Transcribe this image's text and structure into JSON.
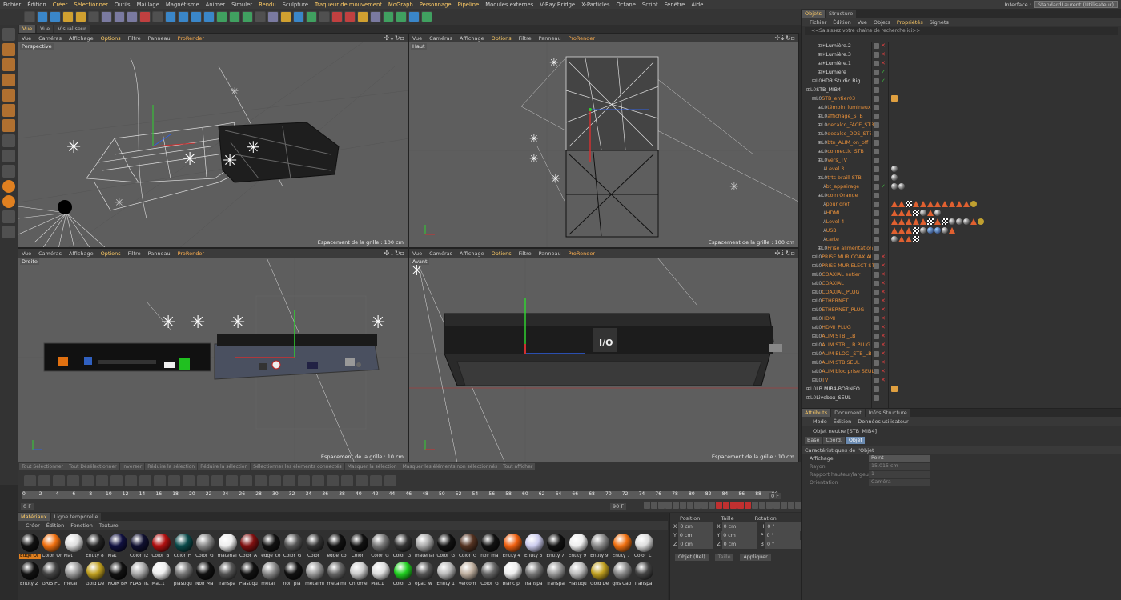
{
  "menubar": [
    "Fichier",
    "Édition",
    "Créer",
    "Sélectionner",
    "Outils",
    "Maillage",
    "Magnétisme",
    "Animer",
    "Simuler",
    "Rendu",
    "Sculpture",
    "Traqueur de mouvement",
    "MoGraph",
    "Personnage",
    "Pipeline",
    "Modules externes",
    "V-Ray Bridge",
    "X-Particles",
    "Octane",
    "Script",
    "Fenêtre",
    "Aide"
  ],
  "interface": {
    "label": "Interface :",
    "value": "StandardLaurent (Utilisateur)"
  },
  "viewport_tabs": [
    "Vue",
    "Vue",
    "Visualiseur"
  ],
  "viewport_menu": {
    "vue": "Vue",
    "cameras": "Caméras",
    "affichage": "Affichage",
    "options": "Options",
    "filtre": "Filtre",
    "panneau": "Panneau",
    "prorender": "ProRender"
  },
  "viewports": [
    {
      "name": "Perspective",
      "grid": "Espacement de la grille : 100 cm"
    },
    {
      "name": "Haut",
      "grid": "Espacement de la grille : 100 cm"
    },
    {
      "name": "Droite",
      "grid": "Espacement de la grille : 10 cm"
    },
    {
      "name": "Avant",
      "grid": "Espacement de la grille : 10 cm"
    }
  ],
  "scene_label": "I/O",
  "right_tabs": [
    "Objets",
    "Structure"
  ],
  "obj_menu": [
    "Fichier",
    "Édition",
    "Vue",
    "Objets",
    "Propriétés",
    "Signets"
  ],
  "search_placeholder": "<<Saisissez votre chaîne de recherche ici>>",
  "objects": [
    {
      "name": "Lumière.2",
      "indent": 2,
      "color": "w",
      "x": "r"
    },
    {
      "name": "Lumière.3",
      "indent": 2,
      "color": "w",
      "x": "r"
    },
    {
      "name": "Lumière.1",
      "indent": 2,
      "color": "w",
      "x": "r"
    },
    {
      "name": "Lumière",
      "indent": 2,
      "color": "w",
      "x": "g"
    },
    {
      "name": "HDR Studio Rig",
      "indent": 1,
      "color": "w",
      "x": "g"
    },
    {
      "name": "STB_MIB4",
      "indent": 0,
      "color": "w",
      "x": ""
    },
    {
      "name": "STB_entier03",
      "indent": 1,
      "color": "o",
      "x": ""
    },
    {
      "name": "témoin_lumineux",
      "indent": 2,
      "color": "o",
      "x": ""
    },
    {
      "name": "affichage_STB",
      "indent": 2,
      "color": "o",
      "x": ""
    },
    {
      "name": "decalco_FACE_STB",
      "indent": 2,
      "color": "o",
      "x": ""
    },
    {
      "name": "decalco_DOS_STB",
      "indent": 2,
      "color": "o",
      "x": ""
    },
    {
      "name": "btn_ALIM_on_off",
      "indent": 2,
      "color": "o",
      "x": ""
    },
    {
      "name": "connectic_STB",
      "indent": 2,
      "color": "o",
      "x": ""
    },
    {
      "name": "vers_TV",
      "indent": 2,
      "color": "o",
      "x": ""
    },
    {
      "name": "Level 3",
      "indent": 3,
      "color": "o",
      "x": ""
    },
    {
      "name": "trts braill STB",
      "indent": 2,
      "color": "o",
      "x": ""
    },
    {
      "name": "bt_appairage",
      "indent": 3,
      "color": "o",
      "x": "g"
    },
    {
      "name": "coin Orange",
      "indent": 2,
      "color": "o",
      "x": ""
    },
    {
      "name": "pour dref",
      "indent": 3,
      "color": "o",
      "x": ""
    },
    {
      "name": "HDMI",
      "indent": 3,
      "color": "o",
      "x": ""
    },
    {
      "name": "Level 4",
      "indent": 3,
      "color": "o",
      "x": ""
    },
    {
      "name": "USB",
      "indent": 3,
      "color": "o",
      "x": ""
    },
    {
      "name": "carte",
      "indent": 3,
      "color": "o",
      "x": ""
    },
    {
      "name": "Prise alimentation",
      "indent": 2,
      "color": "o",
      "x": ""
    },
    {
      "name": "PRISE MUR COAXIAL",
      "indent": 1,
      "color": "o",
      "x": "r"
    },
    {
      "name": "PRISE MUR ELECT STB",
      "indent": 1,
      "color": "o",
      "x": "r"
    },
    {
      "name": "COAXIAL entier",
      "indent": 1,
      "color": "o",
      "x": "r"
    },
    {
      "name": "COAXIAL",
      "indent": 1,
      "color": "o",
      "x": "r"
    },
    {
      "name": "COAXIAL_PLUG",
      "indent": 1,
      "color": "o",
      "x": "r"
    },
    {
      "name": "ETHERNET",
      "indent": 1,
      "color": "o",
      "x": "r"
    },
    {
      "name": "ETHERNET_PLUG",
      "indent": 1,
      "color": "o",
      "x": "r"
    },
    {
      "name": "HDMI",
      "indent": 1,
      "color": "o",
      "x": "r"
    },
    {
      "name": "HDMI_PLUG",
      "indent": 1,
      "color": "o",
      "x": "r"
    },
    {
      "name": "ALIM STB _LB",
      "indent": 1,
      "color": "o",
      "x": "r"
    },
    {
      "name": "ALIM STB _LB PLUG",
      "indent": 1,
      "color": "o",
      "x": "r"
    },
    {
      "name": "ALIM BLOC _STB_LB",
      "indent": 1,
      "color": "o",
      "x": "r"
    },
    {
      "name": "ALIM STB SEUL",
      "indent": 1,
      "color": "o",
      "x": "r"
    },
    {
      "name": "ALIM bloc prise SEUL",
      "indent": 1,
      "color": "o",
      "x": "r"
    },
    {
      "name": "TV",
      "indent": 1,
      "color": "o",
      "x": "r"
    },
    {
      "name": "LB MIB4-BORNEO",
      "indent": 0,
      "color": "w",
      "x": ""
    },
    {
      "name": "Livebox_SEUL",
      "indent": 0,
      "color": "w",
      "x": ""
    }
  ],
  "attr_tabs": [
    "Attributs",
    "Document",
    "Infos Structure"
  ],
  "attr_menu": [
    "Mode",
    "Édition",
    "Données utilisateur"
  ],
  "attr_title": "Objet neutre [STB_MIB4]",
  "attr_subtabs": [
    "Base",
    "Coord.",
    "Objet"
  ],
  "attr_section": "Caractéristiques de l'Objet",
  "attr_rows": [
    {
      "label": "Affichage",
      "value": "Point"
    },
    {
      "label": "Rayon",
      "value": "15.015 cm"
    },
    {
      "label": "Rapport hauteur/largeur",
      "value": "1"
    },
    {
      "label": "Orientation",
      "value": "Caméra"
    }
  ],
  "timeline_buttons": [
    "Tout Sélectionner",
    "Tout Désélectionner",
    "Inverser",
    "Réduire la sélection",
    "Réduire la sélection",
    "Sélectionner les éléments connectés",
    "Masquer la sélection",
    "Masquer les éléments non sélectionnés",
    "Tout afficher"
  ],
  "ruler": [
    0,
    2,
    4,
    6,
    8,
    10,
    12,
    14,
    16,
    18,
    20,
    22,
    24,
    26,
    28,
    30,
    32,
    34,
    36,
    38,
    40,
    42,
    44,
    46,
    48,
    50,
    52,
    54,
    56,
    58,
    60,
    62,
    64,
    66,
    68,
    70,
    72,
    74,
    76,
    78,
    80,
    82,
    84,
    86,
    88,
    90
  ],
  "frame_start": "0 F",
  "frame_end": "90 F",
  "frame_cur": "0 F",
  "mat_tabs": [
    "Matériaux",
    "Ligne temporelle"
  ],
  "mat_menu": [
    "Créer",
    "Édition",
    "Fonction",
    "Texture"
  ],
  "materials": [
    {
      "name": "Edge Or",
      "c": "#111111",
      "sel": true
    },
    {
      "name": "Color_Or",
      "c": "#f07010"
    },
    {
      "name": "Mat",
      "c": "#dddddd"
    },
    {
      "name": "Entity 8",
      "c": "#222222"
    },
    {
      "name": "Mat",
      "c": "#101040"
    },
    {
      "name": "Color_I2",
      "c": "#101030"
    },
    {
      "name": "Color_B",
      "c": "#b01010"
    },
    {
      "name": "Color_H",
      "c": "#0a4a4a"
    },
    {
      "name": "Color_G",
      "c": "#888888"
    },
    {
      "name": "material",
      "c": "#eeeeee"
    },
    {
      "name": "Color_A",
      "c": "#801010"
    },
    {
      "name": "edge_co",
      "c": "#111111"
    },
    {
      "name": "Color_G",
      "c": "#555555"
    },
    {
      "name": "_Color",
      "c": "#333333"
    },
    {
      "name": "edge_co",
      "c": "#111111"
    },
    {
      "name": "_Color",
      "c": "#111111"
    },
    {
      "name": "Color_G",
      "c": "#777777"
    },
    {
      "name": "Color_G",
      "c": "#333333"
    },
    {
      "name": "material",
      "c": "#aaaaaa"
    },
    {
      "name": "Color_G",
      "c": "#111111"
    },
    {
      "name": "Color_G",
      "c": "#553322"
    },
    {
      "name": "noir ma",
      "c": "#111111"
    },
    {
      "name": "Entity 4",
      "c": "#f06010"
    },
    {
      "name": "Entity 5",
      "c": "#ccccee"
    },
    {
      "name": "Entity 7",
      "c": "#111111"
    },
    {
      "name": "Entity 9",
      "c": "#eeeeee"
    },
    {
      "name": "Entity 9",
      "c": "#888888"
    },
    {
      "name": "Entity 7",
      "c": "#f07010"
    },
    {
      "name": "Color_L",
      "c": "#dddddd"
    },
    {
      "name": "Entity 2",
      "c": "#111111"
    },
    {
      "name": "GRIS PL",
      "c": "#444444"
    },
    {
      "name": "metal",
      "c": "#999999"
    },
    {
      "name": "Gold De",
      "c": "#c0a020"
    },
    {
      "name": "NOIR BR",
      "c": "#111111"
    },
    {
      "name": "PLASTIK",
      "c": "#aaaaaa"
    },
    {
      "name": "Mat.1",
      "c": "#eeeeee"
    },
    {
      "name": "plastiqu",
      "c": "#777777"
    },
    {
      "name": "Noir Ma",
      "c": "#111111"
    },
    {
      "name": "Transpa",
      "c": "#555555"
    },
    {
      "name": "Plastiqu",
      "c": "#111111"
    },
    {
      "name": "metal",
      "c": "#888888"
    },
    {
      "name": "noir pla",
      "c": "#111111"
    },
    {
      "name": "metalmi",
      "c": "#999999"
    },
    {
      "name": "metalmi",
      "c": "#666666"
    },
    {
      "name": "Chrome",
      "c": "#cccccc"
    },
    {
      "name": "Mat.1",
      "c": "#dddddd"
    },
    {
      "name": "Color_G",
      "c": "#20d020"
    },
    {
      "name": "opac_w",
      "c": "#555555"
    },
    {
      "name": "Entity 1",
      "c": "#bbbbbb"
    },
    {
      "name": "vercom",
      "c": "#c0b0a0"
    },
    {
      "name": "Color_G",
      "c": "#666666"
    },
    {
      "name": "blanc pl",
      "c": "#eeeeee"
    },
    {
      "name": "Transpa",
      "c": "#777777"
    },
    {
      "name": "Transpa",
      "c": "#999999"
    },
    {
      "name": "Plastiqu",
      "c": "#bbbbbb"
    },
    {
      "name": "Gold De",
      "c": "#c0a020"
    },
    {
      "name": "gris Cab",
      "c": "#888888"
    },
    {
      "name": "Transpa",
      "c": "#444444"
    }
  ],
  "coords": {
    "headers": [
      "Position",
      "Taille",
      "Rotation"
    ],
    "rows": [
      {
        "a": "X",
        "pv": "0 cm",
        "b": "X",
        "sv": "0 cm",
        "c": "H",
        "rv": "0 °"
      },
      {
        "a": "Y",
        "pv": "0 cm",
        "b": "Y",
        "sv": "0 cm",
        "c": "P",
        "rv": "0 °"
      },
      {
        "a": "Z",
        "pv": "0 cm",
        "b": "Z",
        "sv": "0 cm",
        "c": "B",
        "rv": "0 °"
      }
    ],
    "mode": "Objet (Rel)",
    "size_mode": "Taille",
    "apply": "Appliquer"
  }
}
